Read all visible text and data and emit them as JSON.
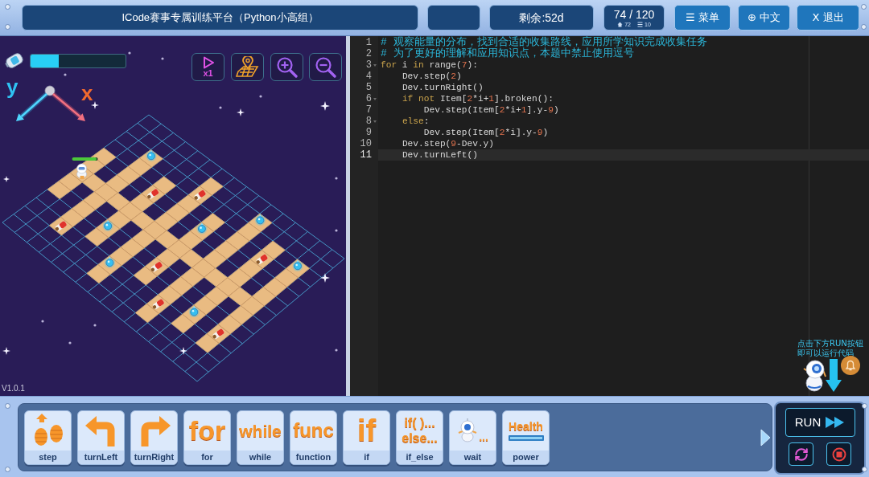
{
  "header": {
    "title": "ICode赛事专属训练平台（Python小高组）",
    "remaining": "剩余:52d",
    "score": "74 / 120",
    "stats": [
      {
        "kind": "house",
        "value": "72"
      },
      {
        "kind": "list",
        "value": "10"
      }
    ],
    "buttons": [
      {
        "label": "☰ 菜单"
      },
      {
        "label": "⊕ 中文"
      },
      {
        "label": "X 退出"
      }
    ]
  },
  "game": {
    "energy": {
      "level": 0.3
    },
    "tools": [
      {
        "kind": "speed",
        "label": "x1"
      },
      {
        "kind": "map"
      },
      {
        "kind": "zoom_in"
      },
      {
        "kind": "zoom_out"
      }
    ],
    "axis_labels": {
      "y": "y",
      "x": "x"
    },
    "robot": {
      "level": 0.95
    },
    "version": "V1.0.1"
  },
  "editor": {
    "lines": [
      {
        "number": "1",
        "active": false,
        "tokens": [
          {
            "kind": "comment",
            "text": "# 观察能量的分布，找到合适的收集路线，应用所学知识完成收集任务"
          }
        ]
      },
      {
        "number": "2",
        "active": false,
        "tokens": [
          {
            "kind": "comment",
            "text": "# 为了更好的理解和应用知识点，本题中禁止使用逗号"
          }
        ]
      },
      {
        "number": "3",
        "active": false,
        "tokens": [
          {
            "kind": "keyword",
            "text": "for"
          },
          {
            "kind": "plain",
            "text": " i "
          },
          {
            "kind": "keyword",
            "text": "in"
          },
          {
            "kind": "plain",
            "text": " range("
          },
          {
            "kind": "number",
            "text": "7"
          },
          {
            "kind": "plain",
            "text": "):"
          }
        ],
        "children": [
          {
            "number": "4",
            "active": false,
            "tokens": [
              {
                "kind": "plain",
                "text": "Dev.step("
              },
              {
                "kind": "number",
                "text": "2"
              },
              {
                "kind": "plain",
                "text": ")"
              }
            ]
          },
          {
            "number": "5",
            "active": false,
            "tokens": [
              {
                "kind": "plain",
                "text": "Dev.turnRight()"
              }
            ]
          },
          {
            "number": "6",
            "active": false,
            "tokens": [
              {
                "kind": "keyword",
                "text": "if not"
              },
              {
                "kind": "plain",
                "text": " Item["
              },
              {
                "kind": "number",
                "text": "2"
              },
              {
                "kind": "plain",
                "text": "*i+"
              },
              {
                "kind": "number",
                "text": "1"
              },
              {
                "kind": "plain",
                "text": "].broken():"
              }
            ],
            "children": [
              {
                "number": "7",
                "active": false,
                "tokens": [
                  {
                    "kind": "plain",
                    "text": "Dev.step(Item["
                  },
                  {
                    "kind": "number",
                    "text": "2"
                  },
                  {
                    "kind": "plain",
                    "text": "*i+"
                  },
                  {
                    "kind": "number",
                    "text": "1"
                  },
                  {
                    "kind": "plain",
                    "text": "].y-"
                  },
                  {
                    "kind": "number",
                    "text": "9"
                  },
                  {
                    "kind": "plain",
                    "text": ")"
                  }
                ]
              }
            ]
          },
          {
            "number": "8",
            "active": false,
            "tokens": [
              {
                "kind": "keyword",
                "text": "else"
              },
              {
                "kind": "plain",
                "text": ":"
              }
            ],
            "children": [
              {
                "number": "9",
                "active": false,
                "tokens": [
                  {
                    "kind": "plain",
                    "text": "Dev.step(Item["
                  },
                  {
                    "kind": "number",
                    "text": "2"
                  },
                  {
                    "kind": "plain",
                    "text": "*i].y-"
                  },
                  {
                    "kind": "number",
                    "text": "9"
                  },
                  {
                    "kind": "plain",
                    "text": ")"
                  }
                ]
              }
            ]
          },
          {
            "number": "10",
            "active": false,
            "tokens": [
              {
                "kind": "plain",
                "text": "Dev.step("
              },
              {
                "kind": "number",
                "text": "9"
              },
              {
                "kind": "plain",
                "text": "-Dev.y)"
              }
            ]
          },
          {
            "number": "11",
            "active": true,
            "tokens": [
              {
                "kind": "plain",
                "text": "Dev.turnLeft()"
              }
            ]
          }
        ]
      }
    ],
    "hint": "点击下方RUN按钮即可以运行代码"
  },
  "blocks": [
    {
      "kind": "footsteps",
      "label": "step"
    },
    {
      "kind": "turn_left",
      "label": "turnLeft"
    },
    {
      "kind": "turn_right",
      "label": "turnRight"
    },
    {
      "kind": "word",
      "glyphs": [
        "for"
      ],
      "label": "for"
    },
    {
      "kind": "word",
      "glyphs": [
        "while"
      ],
      "label": "while"
    },
    {
      "kind": "word",
      "glyphs": [
        "func"
      ],
      "label": "function"
    },
    {
      "kind": "word",
      "glyphs": [
        "if"
      ],
      "label": "if"
    },
    {
      "kind": "word",
      "glyphs": [
        "if( )...",
        "else..."
      ],
      "label": "if_else"
    },
    {
      "kind": "robot",
      "glyphs": [
        "..."
      ],
      "label": "wait"
    },
    {
      "kind": "meter",
      "glyphs": [
        "Health"
      ],
      "label": "power"
    }
  ],
  "run_panel": {
    "run_label": "RUN"
  }
}
